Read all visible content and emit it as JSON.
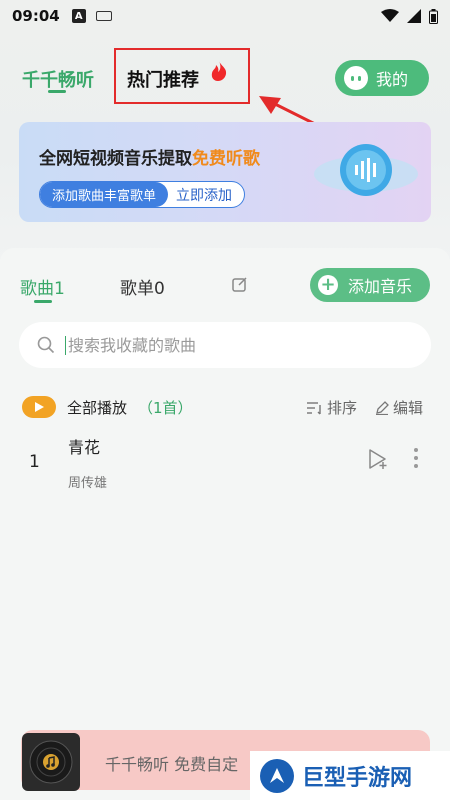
{
  "status_bar": {
    "time": "09:04",
    "a_icon": "A"
  },
  "header": {
    "tab_active": "千千畅听",
    "tab_hot": "热门推荐",
    "my_button": "我的"
  },
  "banner": {
    "title_main": "全网短视频音乐提取",
    "title_highlight": "免费听歌",
    "pill_left": "添加歌曲丰富歌单",
    "pill_right": "立即添加"
  },
  "library": {
    "tab_songs": "歌曲1",
    "tab_playlists": "歌单0",
    "add_music": "添加音乐",
    "search_placeholder": "搜索我收藏的歌曲",
    "play_all": "全部播放",
    "play_all_count": "（1首）",
    "sort_label": "排序",
    "edit_label": "编辑"
  },
  "songs": [
    {
      "index": "1",
      "title": "青花",
      "artist": "周传雄"
    }
  ],
  "player": {
    "text": "千千畅听 免费自定"
  },
  "watermark": {
    "text": "巨型手游网"
  },
  "colors": {
    "accent": "#3aa86a",
    "highlight": "#f08a1c",
    "annotation": "#e32b2b",
    "play_all": "#f2a324"
  }
}
